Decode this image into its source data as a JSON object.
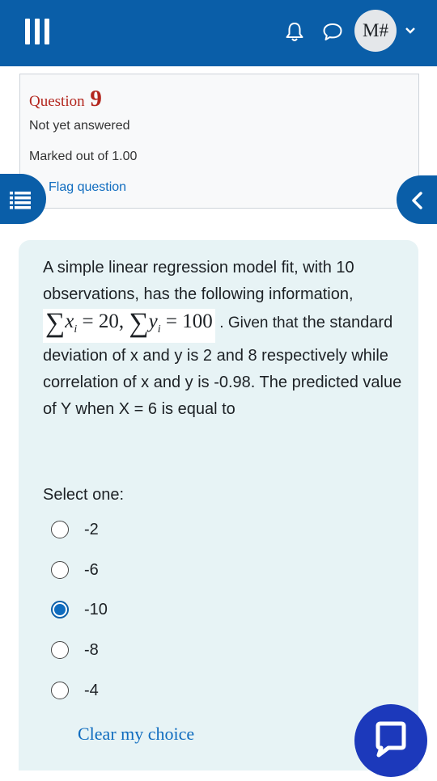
{
  "header": {
    "avatar_text": "M#",
    "icons": [
      "hamburger-icon",
      "bell-icon",
      "chat-icon",
      "chevron-down-icon"
    ],
    "colors": {
      "brand": "#0a5ea8",
      "avatar_bg": "#e4e7ea"
    }
  },
  "question_info": {
    "label": "Question",
    "number": "9",
    "state": "Not yet answered",
    "grade": "Marked out of 1.00",
    "flag_label": "Flag question"
  },
  "question": {
    "text_intro": "A simple linear regression model fit, with 10 observations, has the following information,",
    "formula_x": "x",
    "formula_x_sub": "i",
    "formula_x_value": " = 20",
    "formula_y": "y",
    "formula_y_sub": "i",
    "formula_y_value": " = 100",
    "text_given": ". Given that",
    "text_rest": "the standard deviation of x and y is 2 and 8 respectively while correlation of x and y is -0.98. The predicted value of Y when X = 6 is equal to"
  },
  "answer": {
    "select_label": "Select one:",
    "options": [
      {
        "label": "-2",
        "checked": false
      },
      {
        "label": "-6",
        "checked": false
      },
      {
        "label": "-10",
        "checked": true
      },
      {
        "label": "-8",
        "checked": false
      },
      {
        "label": "-4",
        "checked": false
      }
    ],
    "clear_label": "Clear my choice"
  },
  "floating": {
    "chat_button_color": "#1c39bb"
  }
}
